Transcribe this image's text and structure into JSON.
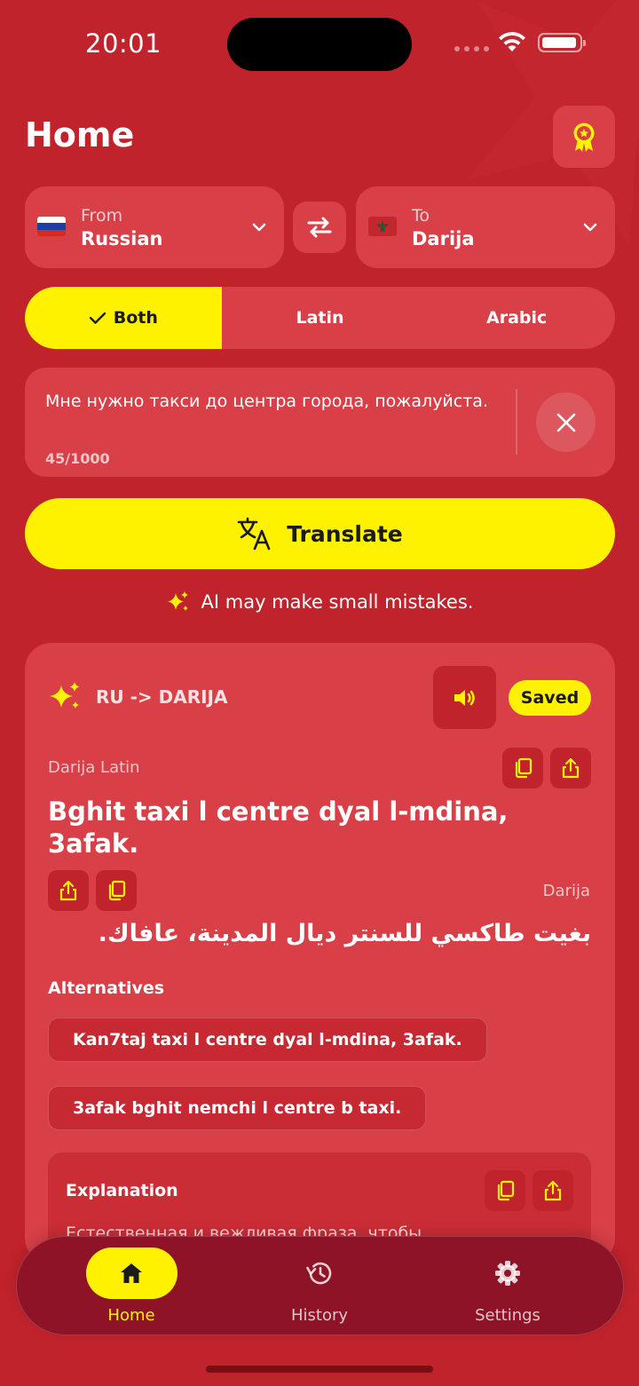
{
  "status_bar": {
    "time": "20:01"
  },
  "header": {
    "title": "Home"
  },
  "languages": {
    "from": {
      "label": "From",
      "value": "Russian"
    },
    "to": {
      "label": "To",
      "value": "Darija"
    }
  },
  "script_modes": {
    "options": [
      "Both",
      "Latin",
      "Arabic"
    ],
    "selected": "Both"
  },
  "input": {
    "text": "Мне нужно такси до центра города, пожалуйста.",
    "counter": "45/1000"
  },
  "translate_button": {
    "label": "Translate"
  },
  "ai_note": "AI may make small mistakes.",
  "result": {
    "direction": "RU -> DARIJA",
    "saved_badge": "Saved",
    "latin_label": "Darija Latin",
    "latin_text": "Bghit taxi l centre dyal l-mdina, 3afak.",
    "arabic_label": "Darija",
    "arabic_text": "بغيت طاكسي للسنتر ديال المدينة، عافاك.",
    "alternatives_title": "Alternatives",
    "alternatives": [
      "Kan7taj taxi l centre dyal l-mdina, 3afak.",
      "3afak bghit nemchi l centre b taxi."
    ],
    "explanation_title": "Explanation",
    "explanation_text": "Естественная и вежливая фраза, чтобы"
  },
  "tabbar": {
    "items": [
      {
        "label": "Home",
        "icon": "home-icon",
        "active": true
      },
      {
        "label": "History",
        "icon": "history-icon",
        "active": false
      },
      {
        "label": "Settings",
        "icon": "gear-icon",
        "active": false
      }
    ]
  },
  "colors": {
    "background": "#c1232c",
    "surface": "#d83f47",
    "accent": "#fff200",
    "tabbar": "#8f1326"
  }
}
